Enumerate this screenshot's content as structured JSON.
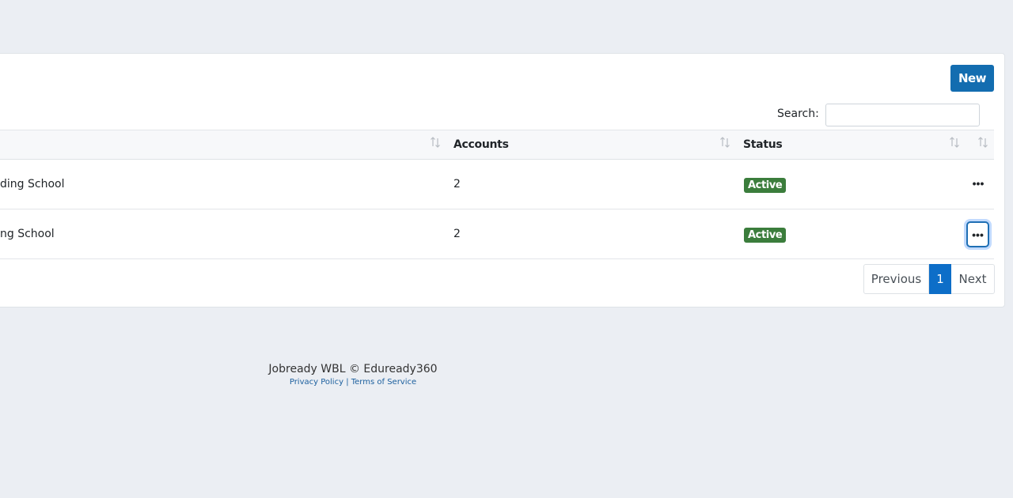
{
  "toolbar": {
    "new_label": "New"
  },
  "search": {
    "label": "Search:",
    "value": "",
    "placeholder": ""
  },
  "table": {
    "columns": [
      {
        "label": ""
      },
      {
        "label": "Accounts"
      },
      {
        "label": "Status"
      },
      {
        "label": ""
      }
    ],
    "rows": [
      {
        "name": "ding School",
        "accounts": "2",
        "status": "Active"
      },
      {
        "name": "ng School",
        "accounts": "2",
        "status": "Active"
      }
    ]
  },
  "pagination": {
    "previous": "Previous",
    "current": "1",
    "next": "Next"
  },
  "footer": {
    "copyright": "Jobready WBL © Eduready360",
    "privacy": "Privacy Policy",
    "separator": "|",
    "terms": "Terms of Service"
  },
  "colors": {
    "primary": "#136db0",
    "badge_active": "#3b7d3c",
    "page_active": "#0d6ec8",
    "background": "#ebeef3"
  },
  "icons": {
    "sort": "sort-up-down-icon",
    "more": "ellipsis-horizontal-icon"
  }
}
